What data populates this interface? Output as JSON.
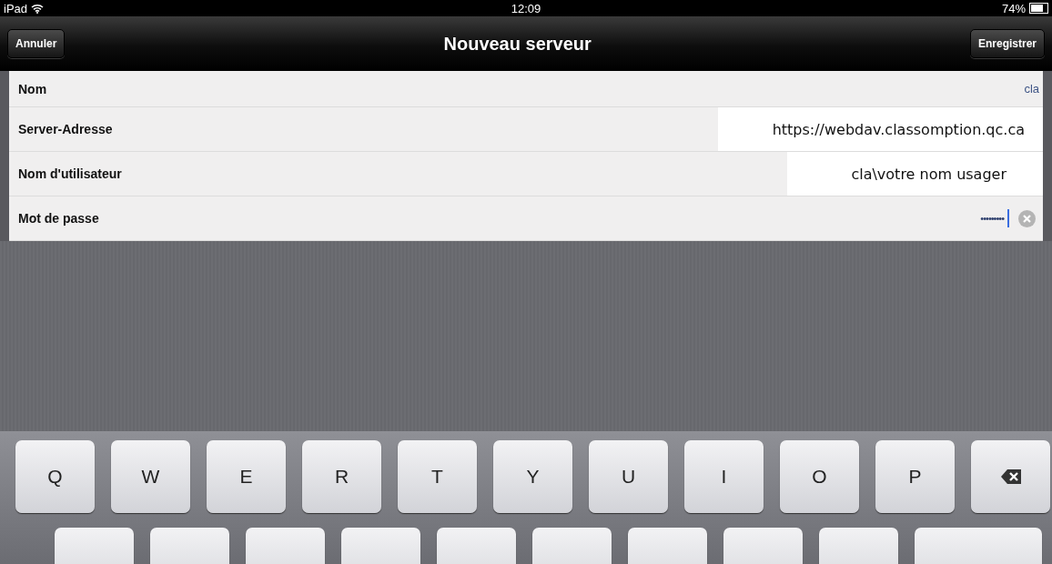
{
  "status_bar": {
    "device": "iPad",
    "time": "12:09",
    "battery": "74%"
  },
  "nav": {
    "title": "Nouveau serveur",
    "left_button": "Annuler",
    "right_button": "Enregistrer"
  },
  "fields": [
    {
      "label": "Nom",
      "value": "cla",
      "kind": "plain"
    },
    {
      "label": "Server-Adresse",
      "value": "https://webdav.classomption.qc.ca",
      "kind": "overlay"
    },
    {
      "label": "Nom d'utilisateur",
      "value": "cla\\votre nom usager",
      "kind": "overlay"
    },
    {
      "label": "Mot de passe",
      "value": "•••••••••",
      "kind": "password"
    }
  ],
  "keyboard": {
    "rows": [
      [
        {
          "label": "Q",
          "kind": "char"
        },
        {
          "label": "W",
          "kind": "char"
        },
        {
          "label": "E",
          "kind": "char"
        },
        {
          "label": "R",
          "kind": "char"
        },
        {
          "label": "T",
          "kind": "char"
        },
        {
          "label": "Y",
          "kind": "char"
        },
        {
          "label": "U",
          "kind": "char"
        },
        {
          "label": "I",
          "kind": "char"
        },
        {
          "label": "O",
          "kind": "char"
        },
        {
          "label": "P",
          "kind": "char"
        },
        {
          "kind": "backspace"
        }
      ],
      [
        {
          "kind": "blank"
        },
        {
          "kind": "blank"
        },
        {
          "kind": "blank"
        },
        {
          "kind": "blank"
        },
        {
          "kind": "blank"
        },
        {
          "kind": "blank"
        },
        {
          "kind": "blank"
        },
        {
          "kind": "blank"
        },
        {
          "kind": "blank"
        },
        {
          "kind": "blank_wide"
        }
      ]
    ]
  }
}
